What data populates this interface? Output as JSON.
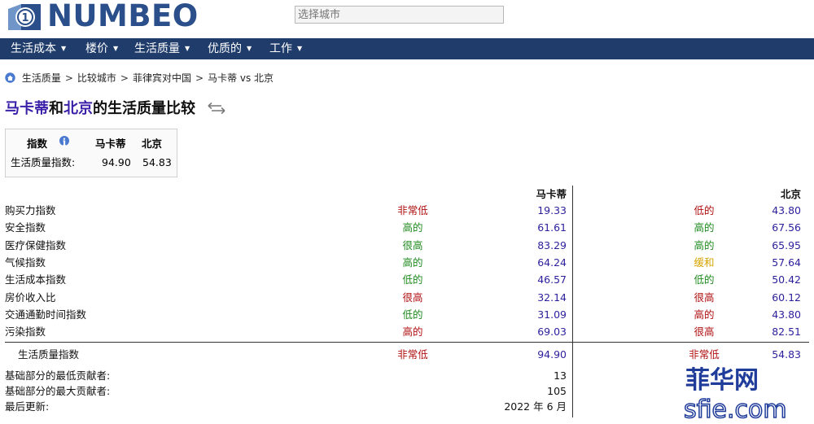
{
  "header": {
    "logo_text": "NUMBEO",
    "search_placeholder": "选择城市"
  },
  "nav": {
    "items": [
      {
        "label": "生活成本"
      },
      {
        "label": "楼价"
      },
      {
        "label": "生活质量"
      },
      {
        "label": "优质的"
      },
      {
        "label": "工作"
      }
    ]
  },
  "breadcrumb": [
    "生活质量",
    "比较城市",
    "菲律宾对中国",
    "马卡蒂 vs 北京"
  ],
  "title": {
    "city1": "马卡蒂",
    "and": "和",
    "city2": "北京",
    "suffix": "的生活质量比较"
  },
  "summary": {
    "col_index": "指数",
    "col_city1": "马卡蒂",
    "col_city2": "北京",
    "row_label": "生活质量指数:",
    "val1": "94.90",
    "val2": "54.83"
  },
  "table": {
    "city1": "马卡蒂",
    "city2": "北京",
    "rows": [
      {
        "label": "购买力指数",
        "lvl1": "非常低",
        "c1": "red",
        "v1": "19.33",
        "lvl2": "低的",
        "c2": "red",
        "v2": "43.80"
      },
      {
        "label": "安全指数",
        "lvl1": "高的",
        "c1": "green",
        "v1": "61.61",
        "lvl2": "高的",
        "c2": "green",
        "v2": "67.56"
      },
      {
        "label": "医疗保健指数",
        "lvl1": "很高",
        "c1": "green",
        "v1": "83.29",
        "lvl2": "高的",
        "c2": "green",
        "v2": "65.95"
      },
      {
        "label": "气候指数",
        "lvl1": "高的",
        "c1": "green",
        "v1": "64.24",
        "lvl2": "缓和",
        "c2": "orange",
        "v2": "57.64"
      },
      {
        "label": "生活成本指数",
        "lvl1": "低的",
        "c1": "green",
        "v1": "46.57",
        "lvl2": "低的",
        "c2": "green",
        "v2": "50.42"
      },
      {
        "label": "房价收入比",
        "lvl1": "很高",
        "c1": "red",
        "v1": "32.14",
        "lvl2": "很高",
        "c2": "red",
        "v2": "60.12"
      },
      {
        "label": "交通通勤时间指数",
        "lvl1": "低的",
        "c1": "green",
        "v1": "31.09",
        "lvl2": "高的",
        "c2": "red",
        "v2": "43.80"
      },
      {
        "label": "污染指数",
        "lvl1": "高的",
        "c1": "red",
        "v1": "69.03",
        "lvl2": "很高",
        "c2": "red",
        "v2": "82.51"
      }
    ],
    "total": {
      "label": "生活质量指数",
      "lvl1": "非常低",
      "v1": "94.90",
      "lvl2": "非常低",
      "v2": "54.83"
    },
    "footer": [
      {
        "label": "基础部分的最低贡献者:",
        "value": "13"
      },
      {
        "label": "基础部分的最大贡献者:",
        "value": "105"
      },
      {
        "label": "最后更新:",
        "value": "2022 年 6 月"
      }
    ]
  },
  "colors": {
    "nav_bg": "#1f3c6b",
    "logo": "#2a4f8a",
    "city_link": "#3a1fa8",
    "value": "#2b1f9c",
    "red": "#b01010",
    "green": "#1f8a1f",
    "orange": "#d8a400"
  },
  "watermark": {
    "line1": "菲华网",
    "line2": "sfie.com"
  }
}
